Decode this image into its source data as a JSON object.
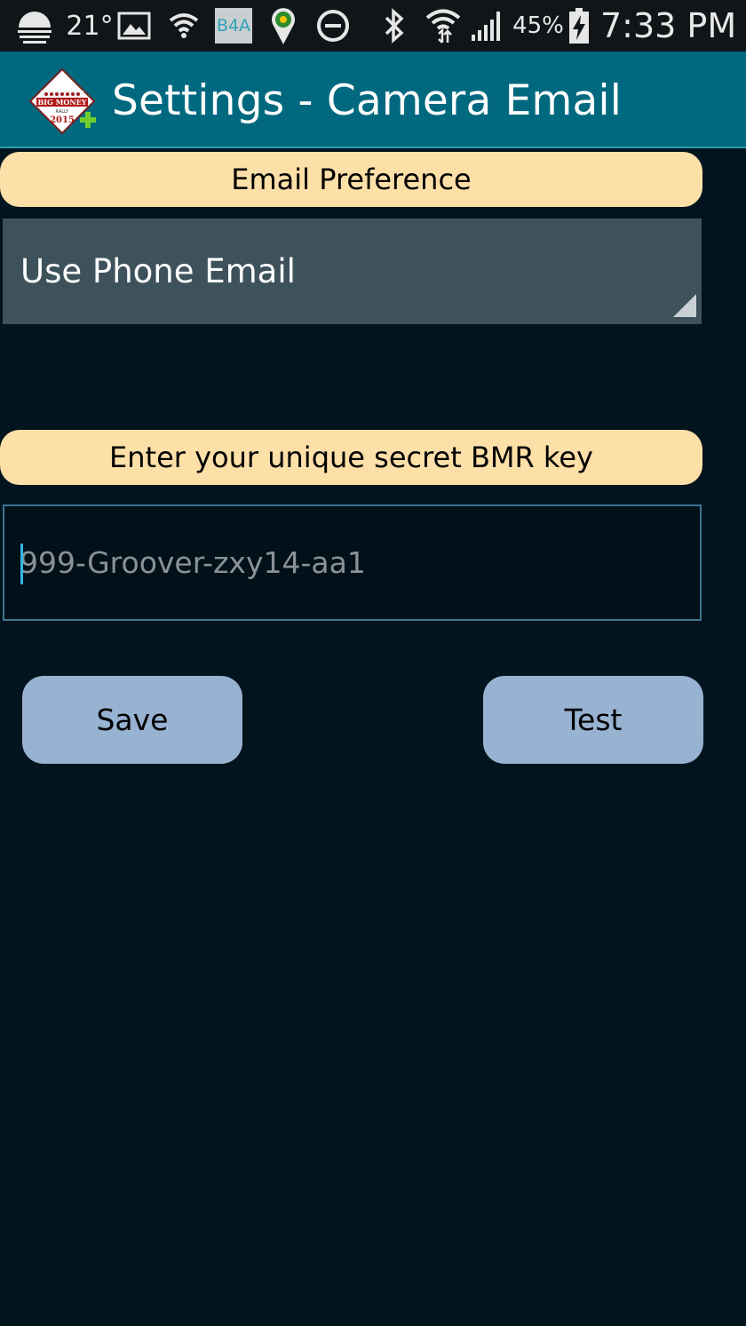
{
  "status_bar": {
    "temperature": "21°",
    "b4a_label": "B4A",
    "battery_percent": "45%",
    "time": "7:33 PM",
    "icons": [
      "weather-icon",
      "image-notification-icon",
      "wifi-notification-icon",
      "b4a-icon",
      "maps-pin-icon",
      "do-not-disturb-icon",
      "bluetooth-icon",
      "wifi-signal-icon",
      "cell-signal-icon",
      "battery-charging-icon"
    ]
  },
  "action_bar": {
    "logo_text_line1": "BIG MONEY",
    "logo_text_line2": "RALLY",
    "logo_year": "2015",
    "title": "Settings - Camera Email"
  },
  "email_preference": {
    "header": "Email Preference",
    "selected": "Use Phone Email"
  },
  "secret_key": {
    "header": "Enter your unique secret BMR  key",
    "value": "",
    "placeholder": "999-Groover-zxy14-aa1"
  },
  "buttons": {
    "save_label": "Save",
    "test_label": "Test"
  },
  "colors": {
    "background": "#02141d",
    "action_bar": "#00697f",
    "header_bg": "#fddfa8",
    "spinner_bg": "#3e525b",
    "button_bg": "#98b2d1",
    "input_border": "#3d7591"
  }
}
